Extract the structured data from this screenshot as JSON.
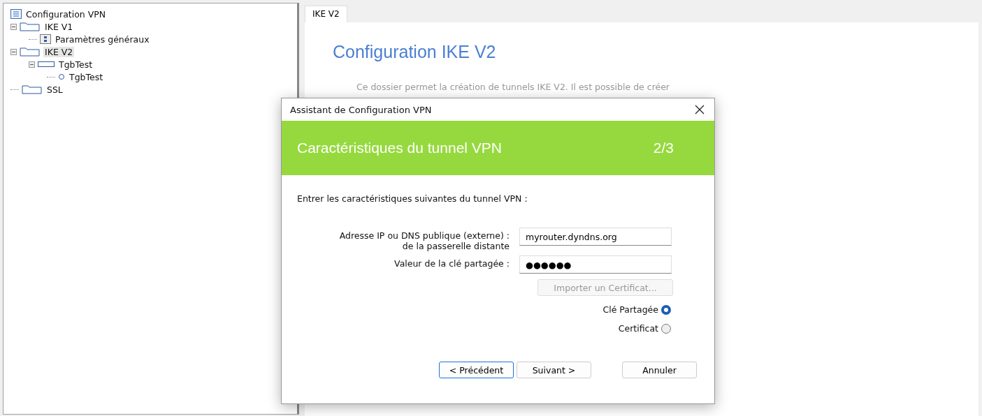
{
  "tree": [
    {
      "label": "Configuration VPN",
      "kind": "list",
      "selected": false,
      "children": [
        {
          "label": "IKE V1",
          "kind": "folder",
          "selected": false,
          "expanded": true,
          "children": [
            {
              "label": "Paramètres généraux",
              "kind": "settings",
              "selected": false
            }
          ]
        },
        {
          "label": "IKE V2",
          "kind": "folder",
          "selected": true,
          "expanded": true,
          "children": [
            {
              "label": "TgbTest",
              "kind": "tunnel",
              "selected": false,
              "expanded": true,
              "children": [
                {
                  "label": "TgbTest",
                  "kind": "circle",
                  "selected": false
                }
              ]
            }
          ]
        },
        {
          "label": "SSL",
          "kind": "folder",
          "selected": false
        }
      ]
    }
  ],
  "tabs": [
    {
      "label": "IKE V2",
      "selected": true
    }
  ],
  "page": {
    "title": "Configuration IKE V2",
    "description": "Ce dossier permet la création de tunnels IKE V2. Il est possible de créer"
  },
  "dialog": {
    "title": "Assistant de Configuration VPN",
    "header": "Caractéristiques du tunnel VPN",
    "step": "2/3",
    "intro": "Entrer les caractéristiques suivantes du tunnel VPN :",
    "fields": [
      {
        "label": "Adresse IP ou DNS publique (externe) :",
        "label_line2": "de la passerelle distante",
        "value": "myrouter.dyndns.org"
      },
      {
        "label": "Valeur de la clé partagée :",
        "value": "●●●●●●"
      }
    ],
    "import_button": {
      "label": "Importer un Certificat...",
      "disabled": true
    },
    "auth_options": [
      {
        "label": "Clé Partagée",
        "selected": true
      },
      {
        "label": "Certificat",
        "selected": false
      }
    ],
    "buttons": [
      {
        "label": "< Précédent",
        "focused": true
      },
      {
        "label": "Suivant >",
        "focused": false
      },
      {
        "label": "Annuler",
        "focused": false
      }
    ]
  }
}
